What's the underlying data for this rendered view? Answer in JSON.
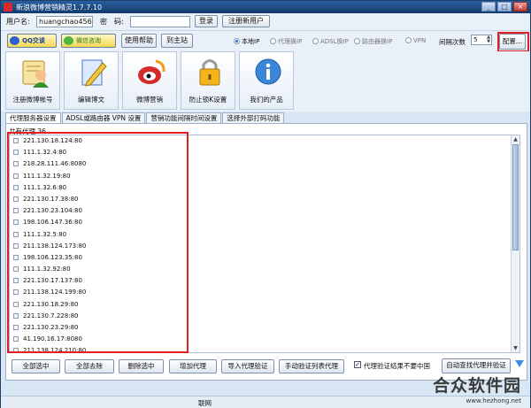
{
  "window": {
    "title": "新浪微博营销精灵1.7.7.10"
  },
  "login": {
    "username_label": "用户名:",
    "username_value": "huangchao456",
    "password_label": "密　码:",
    "password_value": "",
    "login_button": "登录",
    "register_button": "注册新用户"
  },
  "toolbar": {
    "qq_button": "QQ交谈",
    "wechat_button": "微信咨询",
    "help_button": "使用帮助",
    "home_button": "到主站",
    "network_options": [
      {
        "label": "本地IP",
        "selected": true
      },
      {
        "label": "代理换IP",
        "selected": false
      },
      {
        "label": "ADSL换IP",
        "selected": false
      },
      {
        "label": "路由器换IP",
        "selected": false
      },
      {
        "label": "VPN",
        "selected": false
      }
    ],
    "interval_label": "间隔次数",
    "interval_value": "5",
    "config_button": "配置..."
  },
  "tiles": [
    {
      "label": "注册微博帐号",
      "icon": "register-account-icon"
    },
    {
      "label": "编辑博文",
      "icon": "edit-post-icon"
    },
    {
      "label": "微博营销",
      "icon": "weibo-marketing-icon"
    },
    {
      "label": "防止锁K设置",
      "icon": "lock-icon"
    },
    {
      "label": "我们的产品",
      "icon": "info-icon"
    }
  ],
  "tabs": [
    {
      "label": "代理服务器设置",
      "active": true
    },
    {
      "label": "ADSL或路由器 VPN 设置",
      "active": false
    },
    {
      "label": "营销功能间隔时间设置",
      "active": false
    },
    {
      "label": "选择外部打码功能",
      "active": false
    }
  ],
  "proxy": {
    "count_label": "共有代理 36",
    "items": [
      "221.130.18.124:80",
      "111.1.32.4:80",
      "218.28.111.46:8080",
      "111.1.32.19:80",
      "111.1.32.6:80",
      "221.130.17.38:80",
      "221.130.23.104:80",
      "198.106.147.36:80",
      "111.1.32.5:80",
      "211.138.124.173:80",
      "198.106.123.35:80",
      "111.1.32.92:80",
      "221.130.17.137:80",
      "211.138.124.199:80",
      "221.130.18.29:80",
      "221.130.7.228:80",
      "221.130.23.29:80",
      "41.190.16.17:8080",
      "211.138.124.210:80"
    ]
  },
  "actions": {
    "select_all": "全部选中",
    "remove_all": "全部去除",
    "delete_selected": "删除选中",
    "add_proxy": "增加代理",
    "import_verify": "导入代理验证",
    "manual_verify": "手动验证列表代理",
    "exclude_china_label": "代理验证结果不要中国",
    "exclude_china_checked": true,
    "auto_find": "自动查找代理并验证"
  },
  "status": {
    "text": "联网"
  },
  "watermark": {
    "title": "合众软件园",
    "url": "www.hezhong.net"
  },
  "colors": {
    "title_bar": "#1e4a85",
    "highlight": "#e02020",
    "weibo_red": "#d52b2b"
  }
}
